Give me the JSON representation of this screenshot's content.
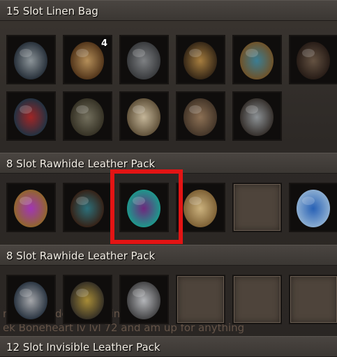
{
  "bags": [
    {
      "title": "15 Slot Linen Bag",
      "slots": [
        {
          "icon": "claw-weapon-icon",
          "colors": [
            "#9aa3a8",
            "#2b3540"
          ]
        },
        {
          "icon": "loot-sack-icon",
          "colors": [
            "#c79d62",
            "#5a3a1c"
          ],
          "count": "4"
        },
        {
          "icon": "armored-chestpiece-icon",
          "colors": [
            "#8a8d90",
            "#3d3f42"
          ]
        },
        {
          "icon": "gloves-icon",
          "colors": [
            "#b78a45",
            "#3a2a18"
          ]
        },
        {
          "icon": "ornate-boots-icon",
          "colors": [
            "#3f8aa3",
            "#7a5a2c"
          ]
        },
        {
          "icon": "leather-boots-icon",
          "colors": [
            "#6e5a48",
            "#2a1e18"
          ]
        },
        {
          "icon": "skull-armor-icon",
          "colors": [
            "#b02828",
            "#243648"
          ]
        },
        {
          "icon": "leggings-icon",
          "colors": [
            "#7e7a66",
            "#3a3628"
          ]
        },
        {
          "icon": "bone-icon",
          "colors": [
            "#d8c8a8",
            "#6a5a40"
          ]
        },
        {
          "icon": "gauntlet-icon",
          "colors": [
            "#9a7b5c",
            "#4a3a2c"
          ]
        },
        {
          "icon": "axe-icon",
          "colors": [
            "#9aa0a4",
            "#3a3430"
          ]
        }
      ]
    },
    {
      "title": "8 Slot Rawhide Leather Pack",
      "slots": [
        {
          "icon": "rune-scroll-icon",
          "colors": [
            "#b03ac8",
            "#a07030"
          ]
        },
        {
          "icon": "hooded-cloak-icon",
          "colors": [
            "#2f7a86",
            "#3a2418"
          ]
        },
        {
          "icon": "purple-leggings-icon",
          "colors": [
            "#7a2a8a",
            "#1fa89a"
          ]
        },
        {
          "icon": "recipe-scroll-icon",
          "colors": [
            "#e0c48a",
            "#8a6a3a"
          ]
        },
        {
          "empty": true
        },
        {
          "icon": "golem-blueprint-icon",
          "colors": [
            "#2a6ac8",
            "#9ac0e8"
          ]
        }
      ]
    },
    {
      "title": "8 Slot Rawhide Leather Pack",
      "slots": [
        {
          "icon": "spear-icon",
          "colors": [
            "#b6b8bc",
            "#2e3a48"
          ]
        },
        {
          "icon": "helmet-icon",
          "colors": [
            "#b89a3c",
            "#3a3428"
          ]
        },
        {
          "icon": "mace-icon",
          "colors": [
            "#c6c8cc",
            "#4a4a4c"
          ]
        },
        {
          "empty": true
        },
        {
          "empty": true
        },
        {
          "empty": true
        }
      ]
    },
    {
      "title": "12 Slot Invisible Leather Pack",
      "slots": []
    }
  ],
  "chat": {
    "line1": "ma    ol  e                        n do something?",
    "line2": "ek Boneheart lv lvl 72 and am up for anything"
  },
  "highlight_color": "#e31414"
}
